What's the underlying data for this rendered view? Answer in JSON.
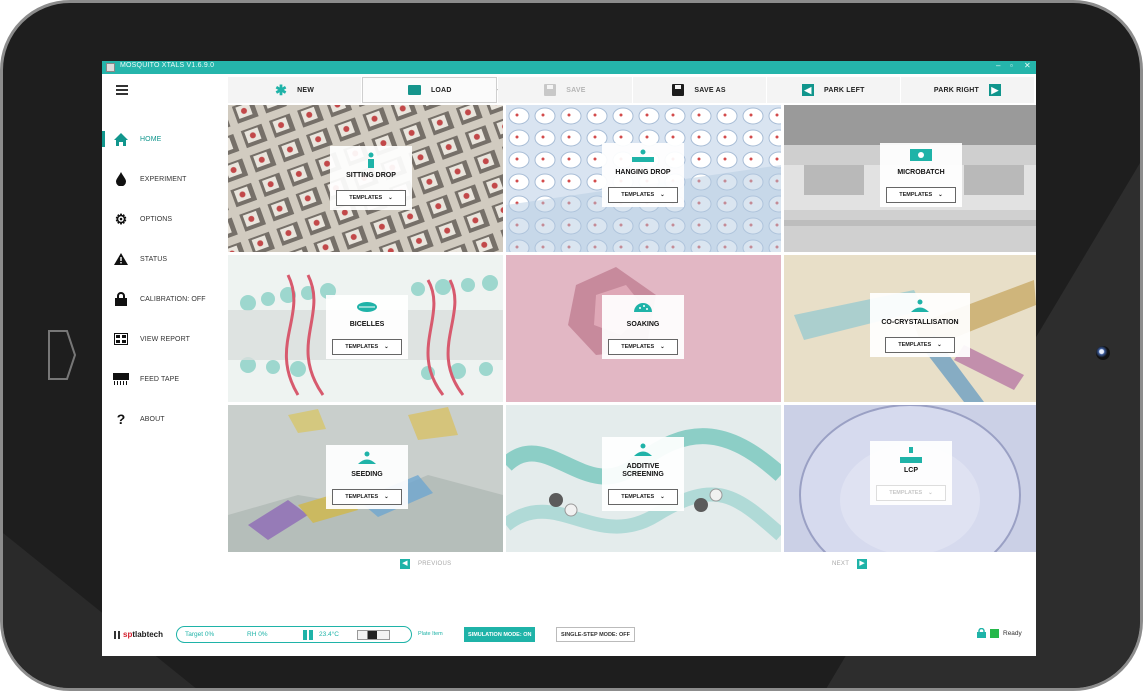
{
  "window": {
    "title": "MOSQUITO XTALS V1.6.9.0",
    "controls": [
      "–",
      "▫",
      "✕"
    ]
  },
  "toolbar": {
    "new": "NEW",
    "load": "LOAD",
    "save": "SAVE",
    "save_as": "SAVE AS",
    "park_left": "PARK LEFT",
    "park_right": "PARK RIGHT"
  },
  "sidebar": {
    "items": [
      {
        "label": "HOME",
        "icon": "home-icon",
        "active": true
      },
      {
        "label": "EXPERIMENT",
        "icon": "drop-icon"
      },
      {
        "label": "OPTIONS",
        "icon": "gear-icon"
      },
      {
        "label": "STATUS",
        "icon": "warning-icon"
      },
      {
        "label": "CALIBRATION: OFF",
        "icon": "lock-icon"
      },
      {
        "label": "VIEW REPORT",
        "icon": "report-icon"
      },
      {
        "label": "FEED TAPE",
        "icon": "tape-icon"
      },
      {
        "label": "ABOUT",
        "icon": "question-icon"
      }
    ]
  },
  "tiles": [
    {
      "title": "SITTING DROP",
      "dropdown": "TEMPLATES"
    },
    {
      "title": "HANGING DROP",
      "dropdown": "TEMPLATES"
    },
    {
      "title": "MICROBATCH",
      "dropdown": "TEMPLATES"
    },
    {
      "title": "BICELLES",
      "dropdown": "TEMPLATES"
    },
    {
      "title": "SOAKING",
      "dropdown": "TEMPLATES"
    },
    {
      "title": "CO-CRYSTALLISATION",
      "dropdown": "TEMPLATES"
    },
    {
      "title": "SEEDING",
      "dropdown": "TEMPLATES"
    },
    {
      "title_line1": "ADDITIVE",
      "title_line2": "SCREENING",
      "dropdown": "TEMPLATES"
    },
    {
      "title": "LCP",
      "dropdown": "TEMPLATES"
    }
  ],
  "pager": {
    "previous": "PREVIOUS",
    "next": "NEXT"
  },
  "status": {
    "brand_prefix": "sp",
    "brand_suffix": "tlabtech",
    "target": "Target 0%",
    "rh": "RH 0%",
    "temperature": "23.4°C",
    "plate_item": "Plate Item",
    "simulation_mode": "SIMULATION MODE: ON",
    "single_step_mode": "SINGLE-STEP MODE: OFF",
    "ready": "Ready"
  },
  "colors": {
    "accent": "#1fb3a8",
    "titlebar": "#25b5ab",
    "ready": "#25b84a"
  }
}
